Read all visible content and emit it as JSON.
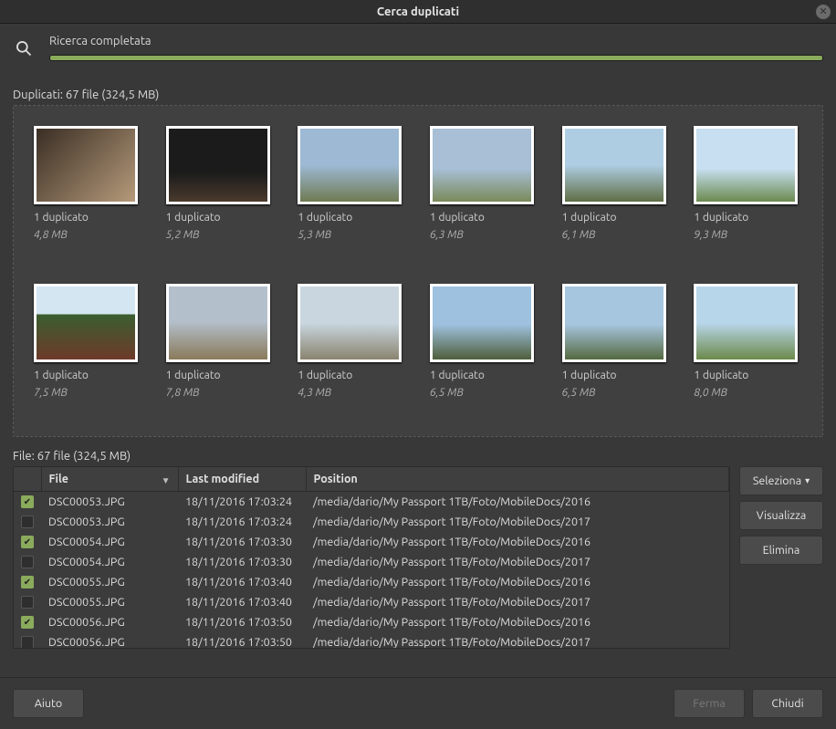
{
  "window": {
    "title": "Cerca duplicati"
  },
  "search": {
    "status": "Ricerca completata",
    "progress_pct": 100
  },
  "duplicates": {
    "heading_prefix": "Duplicati:",
    "summary": "67 file (324,5 MB)",
    "items": [
      {
        "dup_label": "1 duplicato",
        "size": "4,8 MB",
        "style": "g1"
      },
      {
        "dup_label": "1 duplicato",
        "size": "5,2 MB",
        "style": "g2"
      },
      {
        "dup_label": "1 duplicato",
        "size": "5,3 MB",
        "style": "g3"
      },
      {
        "dup_label": "1 duplicato",
        "size": "6,3 MB",
        "style": "g4"
      },
      {
        "dup_label": "1 duplicato",
        "size": "6,1 MB",
        "style": "g5"
      },
      {
        "dup_label": "1 duplicato",
        "size": "9,3 MB",
        "style": "g6"
      },
      {
        "dup_label": "1 duplicato",
        "size": "7,5 MB",
        "style": "g7"
      },
      {
        "dup_label": "1 duplicato",
        "size": "7,8 MB",
        "style": "g8"
      },
      {
        "dup_label": "1 duplicato",
        "size": "4,3 MB",
        "style": "g9"
      },
      {
        "dup_label": "1 duplicato",
        "size": "6,5 MB",
        "style": "g10"
      },
      {
        "dup_label": "1 duplicato",
        "size": "6,5 MB",
        "style": "g11"
      },
      {
        "dup_label": "1 duplicato",
        "size": "8,0 MB",
        "style": "g12"
      }
    ]
  },
  "files": {
    "heading_prefix": "File:",
    "summary": "67 file (324,5 MB)",
    "columns": {
      "file": "File",
      "modified": "Last modified",
      "position": "Position"
    },
    "rows": [
      {
        "checked": true,
        "file": "DSC00053.JPG",
        "modified": "18/11/2016 17:03:24",
        "position": "/media/dario/My Passport 1TB/Foto/MobileDocs/2016"
      },
      {
        "checked": false,
        "file": "DSC00053.JPG",
        "modified": "18/11/2016 17:03:24",
        "position": "/media/dario/My Passport 1TB/Foto/MobileDocs/2017"
      },
      {
        "checked": true,
        "file": "DSC00054.JPG",
        "modified": "18/11/2016 17:03:30",
        "position": "/media/dario/My Passport 1TB/Foto/MobileDocs/2016"
      },
      {
        "checked": false,
        "file": "DSC00054.JPG",
        "modified": "18/11/2016 17:03:30",
        "position": "/media/dario/My Passport 1TB/Foto/MobileDocs/2017"
      },
      {
        "checked": true,
        "file": "DSC00055.JPG",
        "modified": "18/11/2016 17:03:40",
        "position": "/media/dario/My Passport 1TB/Foto/MobileDocs/2016"
      },
      {
        "checked": false,
        "file": "DSC00055.JPG",
        "modified": "18/11/2016 17:03:40",
        "position": "/media/dario/My Passport 1TB/Foto/MobileDocs/2017"
      },
      {
        "checked": true,
        "file": "DSC00056.JPG",
        "modified": "18/11/2016 17:03:50",
        "position": "/media/dario/My Passport 1TB/Foto/MobileDocs/2016"
      },
      {
        "checked": false,
        "file": "DSC00056.JPG",
        "modified": "18/11/2016 17:03:50",
        "position": "/media/dario/My Passport 1TB/Foto/MobileDocs/2017"
      }
    ]
  },
  "side": {
    "select": "Seleziona",
    "view": "Visualizza",
    "delete": "Elimina"
  },
  "footer": {
    "help": "Aiuto",
    "stop": "Ferma",
    "close": "Chiudi"
  }
}
